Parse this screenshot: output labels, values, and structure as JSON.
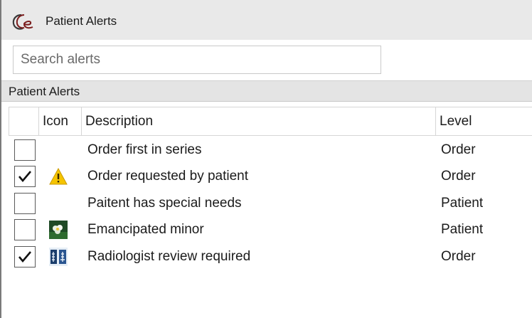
{
  "window": {
    "title": "Patient Alerts",
    "logo_icon": "app-logo-icon"
  },
  "search": {
    "placeholder": "Search alerts",
    "value": ""
  },
  "section": {
    "title": "Patient Alerts"
  },
  "table": {
    "columns": {
      "check": "",
      "icon": "Icon",
      "description": "Description",
      "level": "Level"
    },
    "rows": [
      {
        "checked": false,
        "icon": "",
        "description": "Order first in series",
        "level": "Order"
      },
      {
        "checked": true,
        "icon": "warning-icon",
        "description": "Order requested by patient",
        "level": "Order"
      },
      {
        "checked": false,
        "icon": "",
        "description": "Paitent has special needs",
        "level": "Patient"
      },
      {
        "checked": false,
        "icon": "flower-photo-icon",
        "description": "Emancipated minor",
        "level": "Patient"
      },
      {
        "checked": true,
        "icon": "xray-icon",
        "description": "Radiologist review required",
        "level": "Order"
      }
    ]
  },
  "colors": {
    "titlebar": "#e9e9e9",
    "section_header": "#e4e4e4",
    "warning": "#f5c400"
  }
}
